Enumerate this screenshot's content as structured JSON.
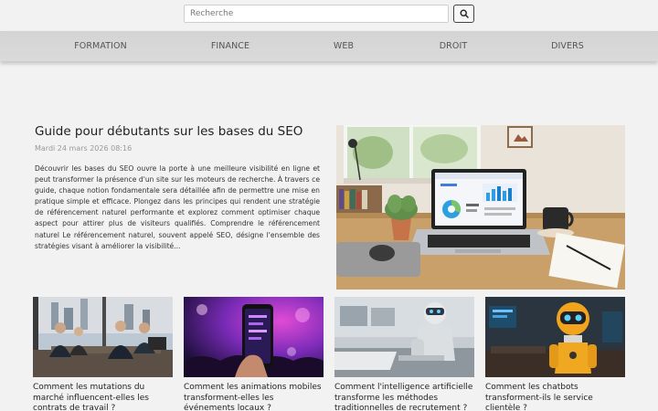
{
  "search": {
    "placeholder": "Recherche"
  },
  "nav": {
    "items": [
      "FORMATION",
      "FINANCE",
      "WEB",
      "DROIT",
      "DIVERS"
    ]
  },
  "featured": {
    "title": "Guide pour débutants sur les bases du SEO",
    "date": "Mardi 24 mars 2026 08:16",
    "excerpt": "Découvrir les bases du SEO ouvre la porte à une meilleure visibilité en ligne et peut transformer la présence d'un site sur les moteurs de recherche. À travers ce guide, chaque notion fondamentale sera détaillée afin de permettre une mise en pratique simple et efficace. Plongez dans les principes qui rendent une stratégie de référencement naturel performante et explorez comment optimiser chaque aspect pour attirer plus de visiteurs qualifiés. Comprendre le référencement naturel Le référencement naturel, souvent appelé SEO, désigne l'ensemble des stratégies visant à améliorer la visibilité..."
  },
  "cards": [
    {
      "title": "Comment les mutations du marché influencent-elles les contrats de travail ?"
    },
    {
      "title": "Comment les animations mobiles transforment-elles les événements locaux ?"
    },
    {
      "title": "Comment l'intelligence artificielle transforme les méthodes traditionnelles de recrutement ?"
    },
    {
      "title": "Comment les chatbots transforment-ils le service clientèle ?"
    }
  ]
}
